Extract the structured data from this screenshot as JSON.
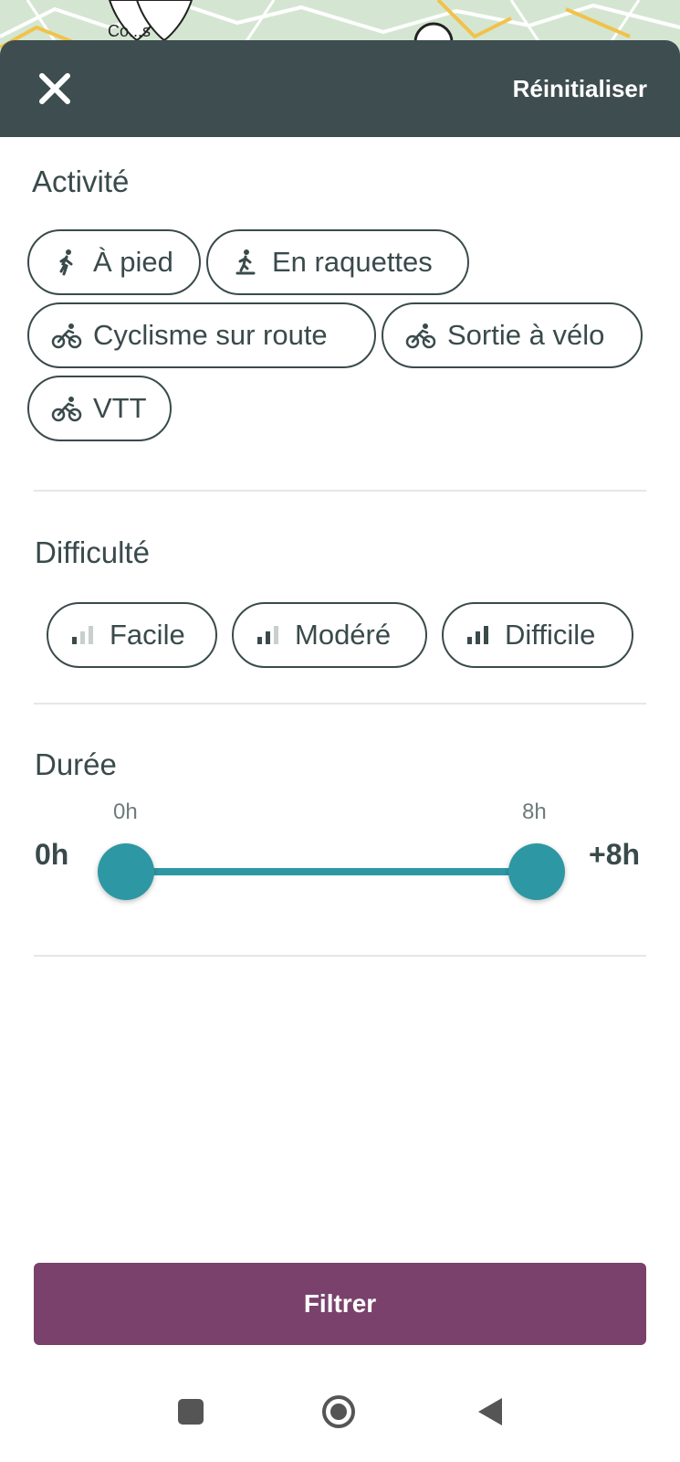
{
  "map": {
    "label": "Co...s"
  },
  "header": {
    "reset_label": "Réinitialiser"
  },
  "activity": {
    "title": "Activité",
    "chips": [
      {
        "label": "À pied",
        "icon": "walking-icon"
      },
      {
        "label": "En raquettes",
        "icon": "snowshoe-icon"
      },
      {
        "label": "Cyclisme sur route",
        "icon": "bike-icon"
      },
      {
        "label": "Sortie à vélo",
        "icon": "bike-icon"
      },
      {
        "label": "VTT",
        "icon": "bike-icon"
      }
    ]
  },
  "difficulty": {
    "title": "Difficulté",
    "chips": [
      {
        "label": "Facile",
        "level": 1
      },
      {
        "label": "Modéré",
        "level": 2
      },
      {
        "label": "Difficile",
        "level": 3
      }
    ]
  },
  "duration": {
    "title": "Durée",
    "min_label": "0h",
    "max_label": "+8h",
    "low_value_label": "0h",
    "high_value_label": "8h",
    "range_min": 0,
    "range_max": 8,
    "low": 0,
    "high": 8
  },
  "filter_button": {
    "label": "Filtrer"
  },
  "colors": {
    "header": "#3e4d4f",
    "accent": "#2d98a3",
    "primary": "#79416b"
  }
}
